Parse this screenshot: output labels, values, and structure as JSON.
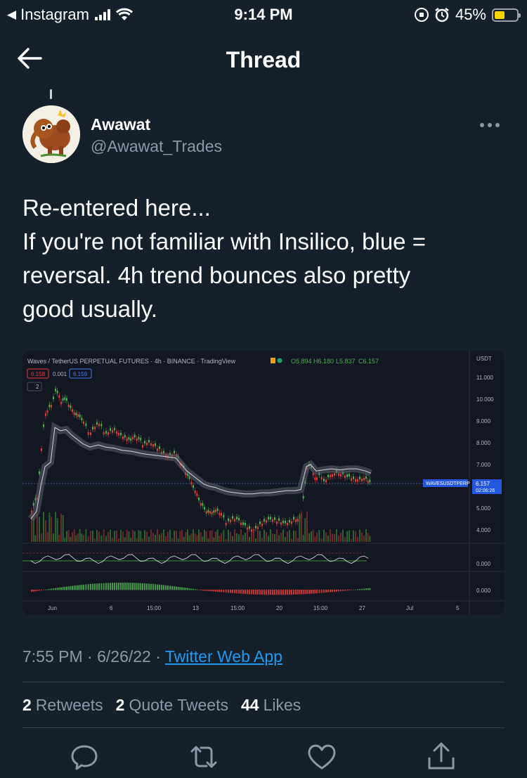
{
  "status_bar": {
    "back_app": "Instagram",
    "time": "9:14 PM",
    "battery": "45%"
  },
  "header": {
    "title": "Thread"
  },
  "author": {
    "name": "Awawat",
    "handle": "@Awawat_Trades"
  },
  "tweet": {
    "lines": [
      "Re-entered here...",
      "If you're not familiar with Insilico, blue =",
      "reversal. 4h trend bounces also pretty",
      "good usually."
    ],
    "time": "7:55 PM",
    "date": "6/26/22",
    "source": "Twitter Web App"
  },
  "chart_image": {
    "title": "Waves / TetherUS PERPETUAL FUTURES · 4h · BINANCE · TradingView",
    "ohlc": {
      "o": "O5.894",
      "h": "H6.180",
      "l": "L5.837",
      "c": "C6.157"
    },
    "price_boxes": [
      "6.158",
      "0.001",
      "6.159"
    ],
    "indicator_count": "2",
    "currency": "USDT",
    "y_ticks": [
      "11.000",
      "10.000",
      "9.000",
      "8.000",
      "7.000",
      "5.000",
      "4.000"
    ],
    "last_symbol": "WAVESUSDTPERP",
    "last_price": "6.157",
    "countdown": "02:06:26",
    "osc_label": "0.000",
    "osc_label2": "0.000",
    "x_ticks": [
      "Jun",
      "6",
      "15:00",
      "13",
      "15:00",
      "20",
      "15:00",
      "27",
      "Jul",
      "5"
    ],
    "colors": {
      "up": "#4caf50",
      "down": "#e53935",
      "bg": "#131722"
    }
  },
  "stats": {
    "retweets_count": "2",
    "retweets_label": "Retweets",
    "quotes_count": "2",
    "quotes_label": "Quote Tweets",
    "likes_count": "44",
    "likes_label": "Likes"
  },
  "actions": [
    "reply-icon",
    "retweet-icon",
    "like-icon",
    "share-icon"
  ]
}
